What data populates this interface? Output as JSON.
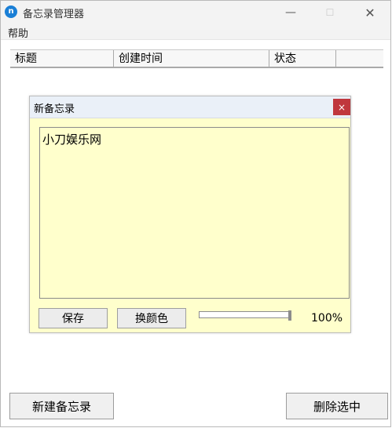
{
  "window": {
    "title": "备忘录管理器",
    "app_icon_glyph": "n",
    "icons": {
      "app": "notes-app-icon",
      "minimize": "minimize-icon",
      "maximize": "maximize-icon",
      "close": "close-icon"
    },
    "buttons": {
      "minimize": "—",
      "maximize": "☐",
      "close": "✕"
    }
  },
  "menu": {
    "items": [
      {
        "label": "帮助"
      }
    ]
  },
  "list": {
    "columns": [
      "标题",
      "创建时间",
      "状态",
      ""
    ]
  },
  "dialog": {
    "title": "新备忘录",
    "close_glyph": "×",
    "note_text": "小刀娱乐网",
    "buttons": {
      "save": "保存",
      "change_color": "换颜色"
    },
    "opacity_slider_value": 1.0,
    "zoom_label": "100%",
    "colors": {
      "background": "#ffffcc",
      "close": "#c0373d"
    }
  },
  "footer": {
    "new_button": "新建备忘录",
    "delete_button": "删除选中"
  }
}
